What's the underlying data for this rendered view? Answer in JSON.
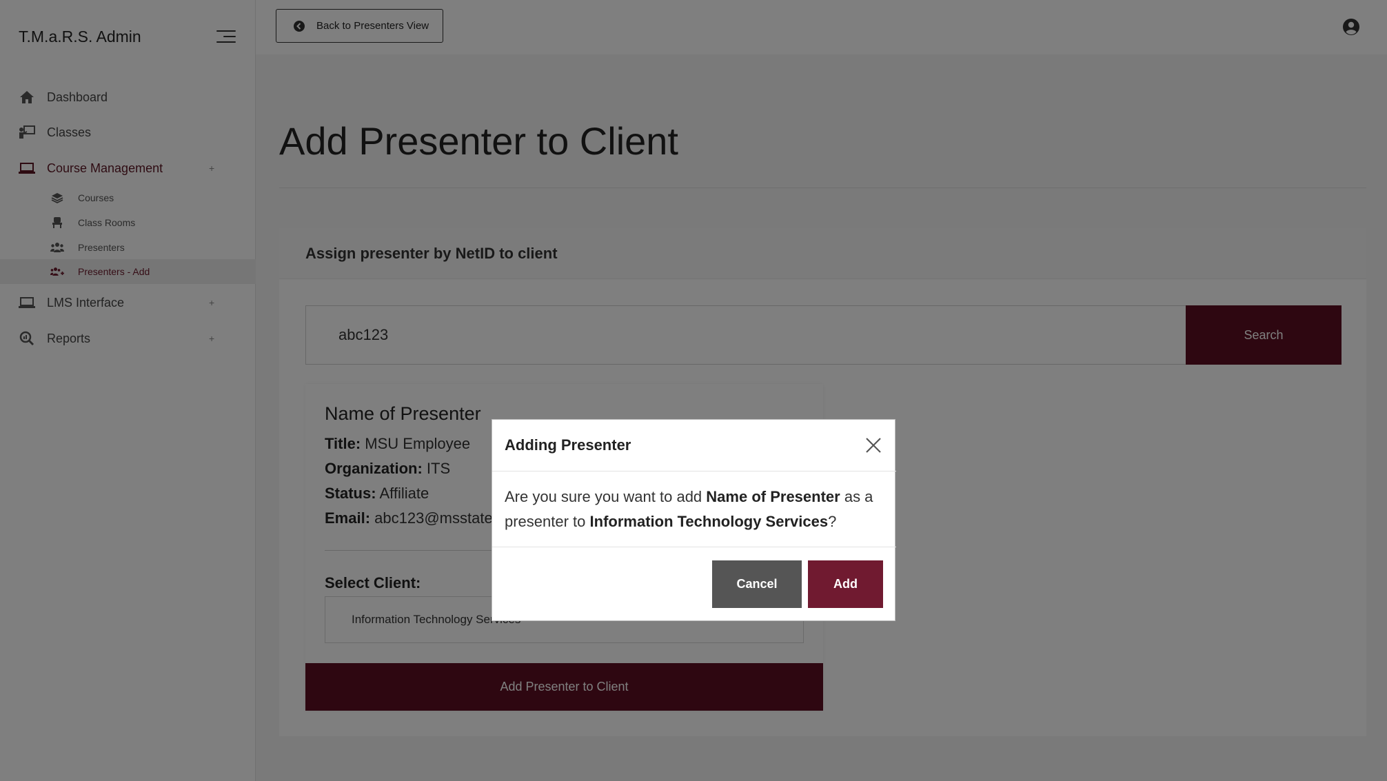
{
  "sidebar": {
    "brand": "T.M.a.R.S. Admin",
    "items": [
      {
        "label": "Dashboard",
        "icon": "home-icon"
      },
      {
        "label": "Classes",
        "icon": "chalkboard-teacher-icon"
      },
      {
        "label": "Course Management",
        "icon": "laptop-icon",
        "expander": "+"
      },
      {
        "label": "LMS Interface",
        "icon": "laptop-icon",
        "expander": "+"
      },
      {
        "label": "Reports",
        "icon": "search-chart-icon",
        "expander": "+"
      }
    ],
    "subitems": [
      {
        "label": "Courses",
        "icon": "layers-icon"
      },
      {
        "label": "Class Rooms",
        "icon": "chair-icon"
      },
      {
        "label": "Presenters",
        "icon": "users-icon"
      },
      {
        "label": "Presenters - Add",
        "icon": "users-add-icon"
      }
    ]
  },
  "topbar": {
    "back_label": "Back to Presenters View"
  },
  "page": {
    "title": "Add Presenter to Client",
    "card_header": "Assign presenter by NetID to client",
    "search_value": "abc123",
    "search_label": "Search"
  },
  "presenter": {
    "name": "Name of Presenter",
    "title_label": "Title:",
    "title_value": "MSU Employee",
    "org_label": "Organization:",
    "org_value": "ITS",
    "status_label": "Status:",
    "status_value": "Affiliate",
    "email_label": "Email:",
    "email_value": "abc123@msstate.edu",
    "select_label": "Select Client:",
    "selected_client": "Information Technology Services",
    "add_button": "Add Presenter to Client"
  },
  "modal": {
    "title": "Adding Presenter",
    "body_pre": "Are you sure you want to add ",
    "body_name": "Name of Presenter",
    "body_mid": " as a presenter to ",
    "body_client": "Information Technology Services",
    "body_post": "?",
    "cancel": "Cancel",
    "add": "Add"
  },
  "colors": {
    "maroon": "#5d0f22",
    "accent_text": "#5d1725",
    "cancel_gray": "#555555"
  }
}
